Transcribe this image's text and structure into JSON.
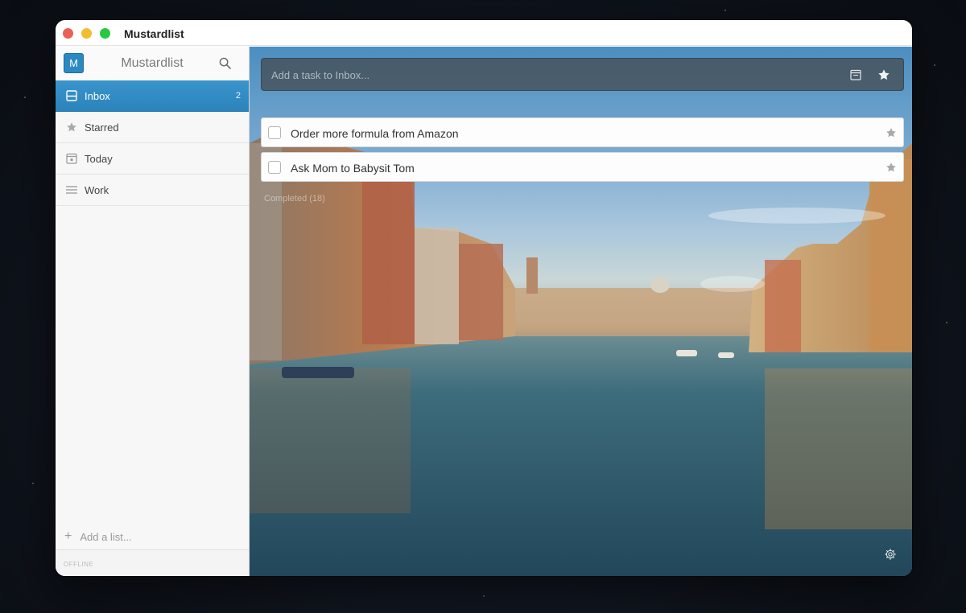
{
  "window": {
    "title": "Mustardlist"
  },
  "sidebar": {
    "avatar_letter": "M",
    "title": "Mustardlist",
    "lists": [
      {
        "label": "Inbox",
        "count": "2",
        "icon": "inbox-icon",
        "active": true
      },
      {
        "label": "Starred",
        "count": "",
        "icon": "star-icon",
        "active": false
      },
      {
        "label": "Today",
        "count": "",
        "icon": "calendar-icon",
        "active": false
      },
      {
        "label": "Work",
        "count": "",
        "icon": "list-icon",
        "active": false
      }
    ],
    "add_list_label": "Add a list...",
    "status": "OFFLINE"
  },
  "main": {
    "add_task_placeholder": "Add a task to Inbox...",
    "tasks": [
      {
        "title": "Order more formula from Amazon",
        "starred": false
      },
      {
        "title": "Ask Mom to Babysit Tom",
        "starred": false
      }
    ],
    "completed_label": "Completed (18)"
  },
  "colors": {
    "accent": "#2b88c1",
    "sidebar_bg": "#f7f7f7",
    "close": "#ed5f56",
    "minimize": "#f3bd2f",
    "maximize": "#28c840"
  }
}
